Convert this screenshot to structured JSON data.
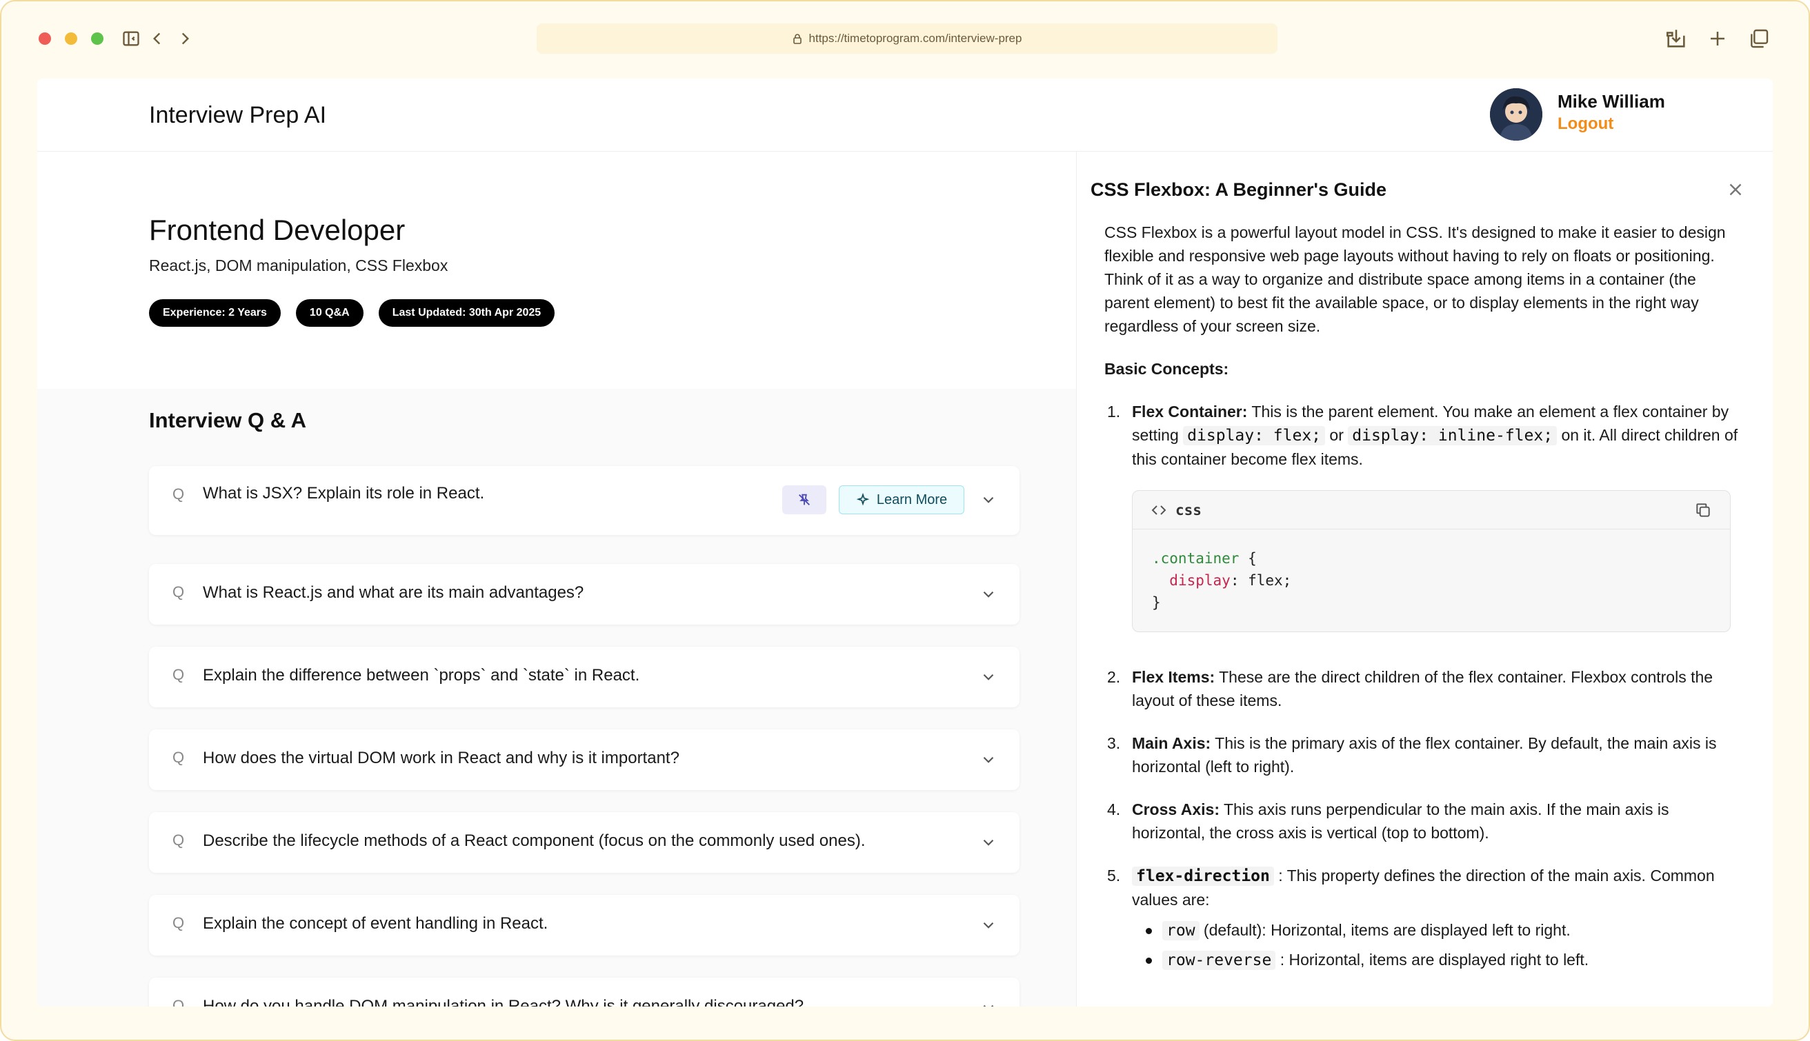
{
  "browser": {
    "url": "https://timetoprogram.com/interview-prep"
  },
  "header": {
    "app_title": "Interview Prep AI",
    "user_name": "Mike William",
    "logout_label": "Logout"
  },
  "session": {
    "role": "Frontend Developer",
    "topics": "React.js, DOM manipulation, CSS Flexbox",
    "pills": [
      "Experience: 2 Years",
      "10 Q&A",
      "Last Updated: 30th Apr 2025"
    ]
  },
  "qa": {
    "heading": "Interview Q & A",
    "q_marker": "Q",
    "learn_more_label": "Learn More",
    "questions": [
      "What is JSX? Explain its role in React.",
      "What is React.js and what are its main advantages?",
      "Explain the difference between `props` and `state` in React.",
      "How does the virtual DOM work in React and why is it important?",
      "Describe the lifecycle methods of a React component (focus on the commonly used ones).",
      "Explain the concept of event handling in React.",
      "How do you handle DOM manipulation in React? Why is it generally discouraged?"
    ]
  },
  "drawer": {
    "title": "CSS Flexbox: A Beginner's Guide",
    "intro": "CSS Flexbox is a powerful layout model in CSS. It's designed to make it easier to design flexible and responsive web page layouts without having to rely on floats or positioning. Think of it as a way to organize and distribute space among items in a container (the parent element) to best fit the available space, or to display elements in the right way regardless of your screen size.",
    "basic_heading": "Basic Concepts:",
    "item1": {
      "num": "1.",
      "term": "Flex Container:",
      "text_a": " This is the parent element. You make an element a flex container by setting ",
      "code_a": "display: flex;",
      "text_b": " or ",
      "code_b": "display: inline-flex;",
      "text_c": " on it. All direct children of this container become flex items."
    },
    "code_block": {
      "lang": "css",
      "selector": ".container",
      "open": " {",
      "property": "display",
      "value": ": flex;",
      "close": "}"
    },
    "item2": {
      "num": "2.",
      "term": "Flex Items:",
      "text": " These are the direct children of the flex container. Flexbox controls the layout of these items."
    },
    "item3": {
      "num": "3.",
      "term": "Main Axis:",
      "text": " This is the primary axis of the flex container. By default, the main axis is horizontal (left to right)."
    },
    "item4": {
      "num": "4.",
      "term": "Cross Axis:",
      "text": " This axis runs perpendicular to the main axis. If the main axis is horizontal, the cross axis is vertical (top to bottom)."
    },
    "item5": {
      "num": "5.",
      "code": "flex-direction",
      "text": " : This property defines the direction of the main axis. Common values are:"
    },
    "bullets": [
      {
        "code": "row",
        "text": " (default): Horizontal, items are displayed left to right."
      },
      {
        "code": "row-reverse",
        "text": " : Horizontal, items are displayed right to left."
      }
    ]
  }
}
